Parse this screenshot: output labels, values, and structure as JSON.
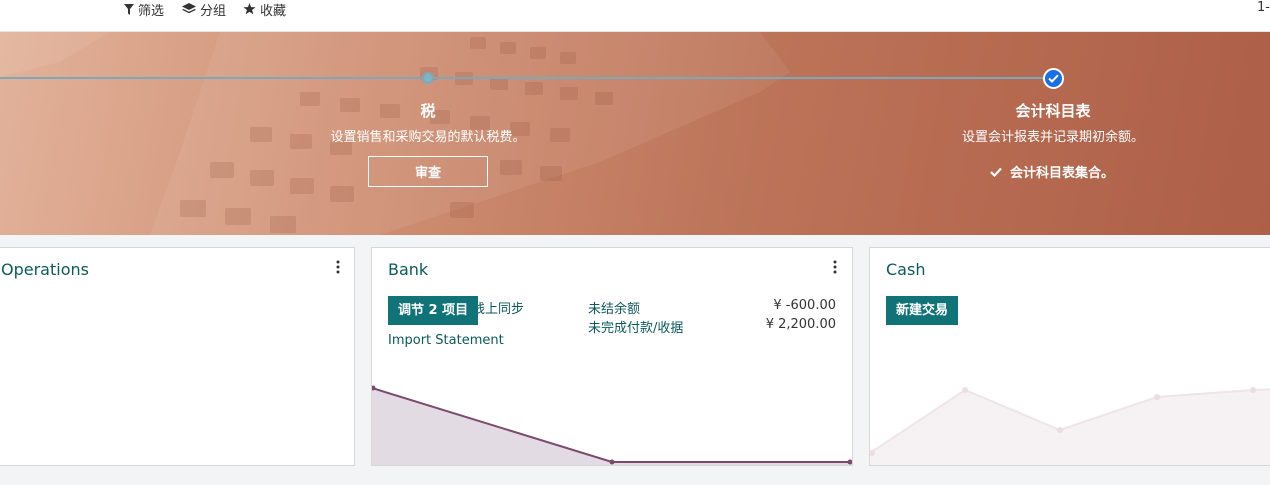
{
  "toolbar": {
    "filter_label": "筛选",
    "group_label": "分组",
    "favorites_label": "收藏",
    "pager": "1-"
  },
  "onboarding": {
    "taxes": {
      "title": "税",
      "description": "设置销售和采购交易的默认税费。",
      "button": "审查"
    },
    "chart_of_accounts": {
      "title": "会计科目表",
      "description": "设置会计报表并记录期初余额。",
      "done_text": "会计科目表集合。"
    }
  },
  "cards": {
    "operations": {
      "title": "Operations"
    },
    "bank": {
      "title": "Bank",
      "reconcile_button": "调节 2 项目",
      "online_sync_link": "线上同步",
      "import_link": "Import Statement",
      "balance_label": "未结余额",
      "balance_value": "¥ -600.00",
      "outstanding_label": "未完成付款/收据",
      "outstanding_value": "¥ 2,200.00"
    },
    "cash": {
      "title": "Cash",
      "new_transaction_button": "新建交易"
    }
  },
  "colors": {
    "accent": "#107378",
    "title": "#0b5a5d",
    "bank_graph_line": "#7b4a6e",
    "bank_graph_fill": "#e3dbe3",
    "cash_graph_line": "#efe4e7"
  }
}
